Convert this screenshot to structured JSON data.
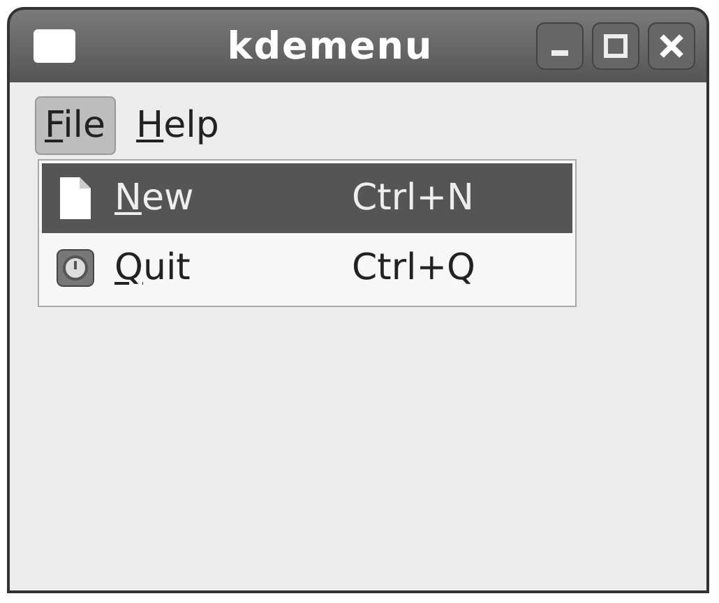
{
  "window": {
    "title": "kdemenu"
  },
  "menubar": [
    {
      "label": "File",
      "mnemonic": true,
      "selected": true
    },
    {
      "label": "Help",
      "mnemonic": true,
      "selected": false
    }
  ],
  "menu": [
    {
      "label": "New",
      "shortcut": "Ctrl+N",
      "mnemonic": true,
      "selected": true,
      "kind": "document"
    },
    {
      "label": "Quit",
      "shortcut": "Ctrl+Q",
      "mnemonic": true,
      "selected": false,
      "kind": "quit"
    }
  ]
}
